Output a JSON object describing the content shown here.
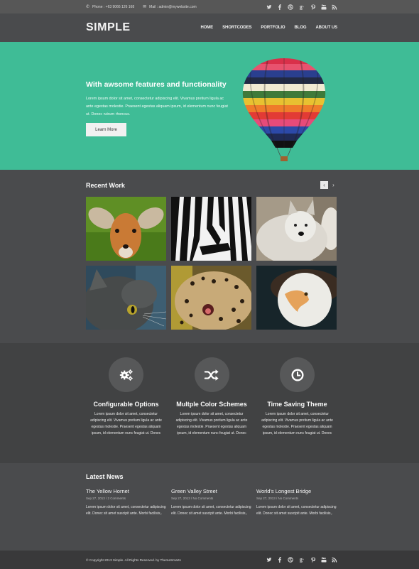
{
  "topbar": {
    "phone_icon": "phone-icon",
    "phone": "Phone : +63 9066 126 168",
    "mail_icon": "envelope-icon",
    "mail": "Mail : admin@mywebsite.com",
    "social": [
      "twitter-icon",
      "facebook-icon",
      "dribbble-icon",
      "google-plus-icon",
      "pinterest-icon",
      "youtube-icon",
      "rss-icon"
    ]
  },
  "header": {
    "logo": "SIMPLE",
    "nav": [
      "HOME",
      "SHORTCODES",
      "PORTFOLIO",
      "BLOG",
      "ABOUT US"
    ]
  },
  "hero": {
    "title": "With awsome features and functionality",
    "text": "Lorem ipsum dolor sit amet, consectetur adipiscing elit. Vivamus pretium ligula ac ante egestas molestie. Praesent egestas aliquam ipsum, id elementum nunc feugiat ut. Donec rutrum rhoncus.",
    "button": "Learn More",
    "image": "hot-air-balloon",
    "bg_color": "#3fbc96"
  },
  "recent_work": {
    "title": "Recent Work",
    "prev_icon": "chevron-left-icon",
    "next_icon": "chevron-right-icon",
    "items": [
      "antelope",
      "zebra",
      "wolf",
      "cat",
      "leopard",
      "eagle"
    ]
  },
  "features": [
    {
      "icon": "gears-icon",
      "title": "Configurable Options",
      "text": "Lorem ipsum dolor sit amet, consectetur adipiscing elit. Vivamus pretium ligula ac ante egestas molestie. Praesent egestas aliquam ipsum, id elementum nunc feugiat ut. Donec"
    },
    {
      "icon": "shuffle-icon",
      "title": "Multple Color Schemes",
      "text": "Lorem ipsum dolor sit amet, consectetur adipiscing elit. Vivamus pretium ligula ac ante egestas molestie. Praesent egestas aliquam ipsum, id elementum nunc feugiat ut. Donec"
    },
    {
      "icon": "clock-icon",
      "title": "Time Saving Theme",
      "text": "Lorem ipsum dolor sit amet, consectetur adipiscing elit. Vivamus pretium ligula ac ante egestas molestie. Praesent egestas aliquam ipsum, id elementum nunc feugiat ut. Donec"
    }
  ],
  "news": {
    "title": "Latest News",
    "items": [
      {
        "title": "The Yellow Hornet",
        "meta": "Sep 27, 2013 / 2 Comments",
        "text": "Lorem ipsum dolor sit amet, consectetur adipiscing elit. Donec sit amet suscipit ante. Morbi facilisis,."
      },
      {
        "title": "Green Valley Street",
        "meta": "Sep 27, 2013 / No Comments",
        "text": "Lorem ipsum dolor sit amet, consectetur adipiscing elit. Donec sit amet suscipit ante. Morbi facilisis,."
      },
      {
        "title": "World's Longest Bridge",
        "meta": "Sep 27, 2013 / No Comments",
        "text": "Lorem ipsum dolor sit amet, consectetur adipiscing elit. Donec sit amet suscipit ante. Morbi facilisis,."
      }
    ]
  },
  "footer": {
    "copyright": "© Copyright 2013 Simple. All Rights Reserved. by ThemeSmarts"
  }
}
